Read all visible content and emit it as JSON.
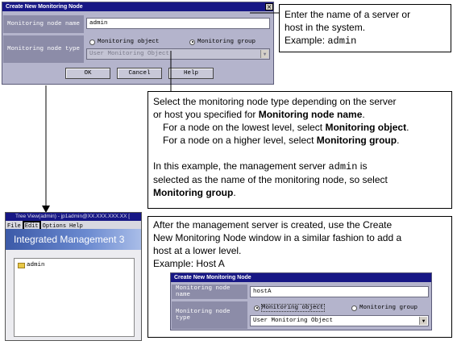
{
  "dialog_top": {
    "title": "Create New Monitoring Node",
    "close": "×",
    "node_name_label": "Monitoring node name",
    "node_name_value": "admin",
    "node_type_label": "Monitoring node type",
    "radio_object": "Monitoring object",
    "radio_group": "Monitoring group",
    "selected_radio": "Monitoring group",
    "select_value": "User Monitoring Object",
    "ok": "OK",
    "cancel": "Cancel",
    "help": "Help"
  },
  "callout_name": {
    "line1": "Enter the name of a server or",
    "line2": "host in the system.",
    "example_prefix": "Example: ",
    "example_value": "admin"
  },
  "callout_type": {
    "l1": "Select the monitoring node type depending on the server",
    "l2_prefix": "or host you specified for ",
    "l2_bold": "Monitoring node name",
    "l2_suffix": ".",
    "l3_prefix": "For a node on the lowest level, select ",
    "l3_bold": "Monitoring object",
    "l3_suffix": ".",
    "l4_prefix": "For a node on a higher level, select ",
    "l4_bold": "Monitoring group",
    "l4_suffix": ".",
    "l5_prefix": "In this example, the management server ",
    "l5_mono": "admin",
    "l5_suffix": " is",
    "l6": "selected as the name of the monitoring node, so select",
    "l7_bold": "Monitoring group",
    "l7_suffix": "."
  },
  "tree_window": {
    "title": "Tree View(admin) - jp1admin@XX.XXX.XXX.XX [",
    "menu": [
      "File",
      "Edit",
      "Options",
      "Help"
    ],
    "banner": "Integrated Management 3",
    "node": "admin"
  },
  "callout_host": {
    "l1": "After the management server is created, use the Create",
    "l2": "New Monitoring Node window in a similar fashion to add a",
    "l3": "host at a lower level.",
    "l4": "Example: Host A"
  },
  "dialog_bottom": {
    "title": "Create New Monitoring Node",
    "node_name_label": "Monitoring node name",
    "node_name_value": "hostA",
    "node_type_label": "Monitoring node type",
    "radio_object": "Monitoring object",
    "radio_group": "Monitoring group",
    "selected_radio": "Monitoring object",
    "select_value": "User Monitoring Object"
  },
  "colors": {
    "title_bar": "#171785",
    "dialog_bg": "#b4b4cc",
    "label_bg": "#8c8ca8",
    "banner": "#3c5aa8"
  }
}
